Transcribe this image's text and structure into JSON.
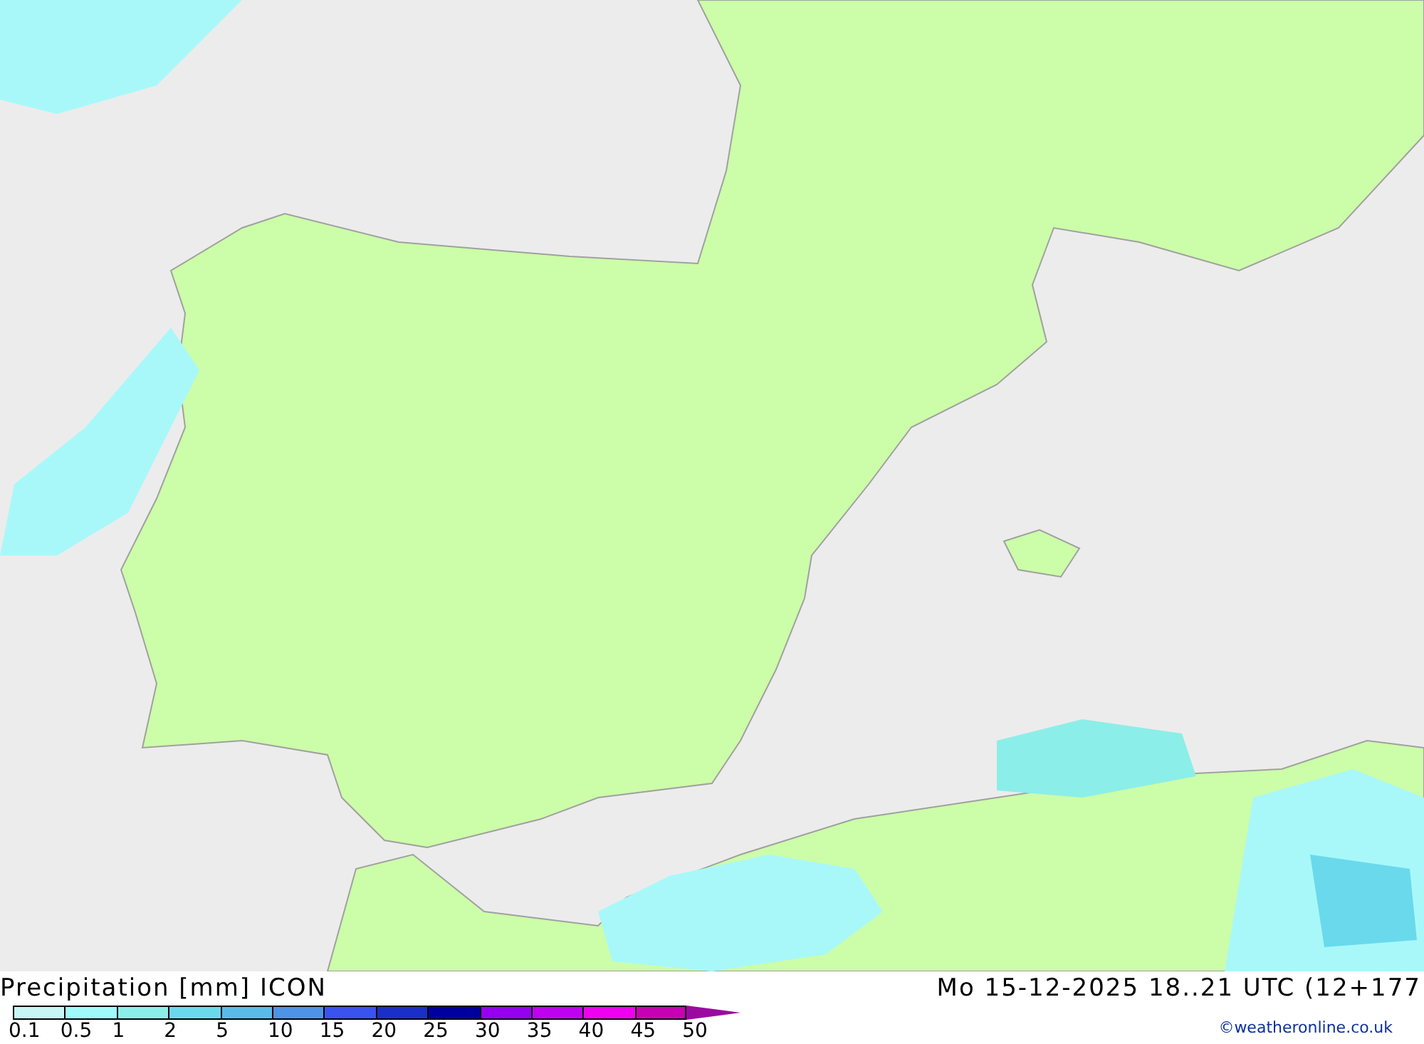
{
  "title": "Precipitation [mm] ICON",
  "valid_time": "Mo 15-12-2025 18..21 UTC (12+177",
  "credit": "©weatheronline.co.uk",
  "legend": [
    {
      "label": "0.1",
      "color": "#c8f5f5"
    },
    {
      "label": "0.5",
      "color": "#a0fafa"
    },
    {
      "label": "1",
      "color": "#8ceee8"
    },
    {
      "label": "2",
      "color": "#6ad9ec"
    },
    {
      "label": "5",
      "color": "#5bbbe8"
    },
    {
      "label": "10",
      "color": "#4f93e6"
    },
    {
      "label": "15",
      "color": "#3a52f0"
    },
    {
      "label": "20",
      "color": "#1a2fc8"
    },
    {
      "label": "25",
      "color": "#0000a0"
    },
    {
      "label": "30",
      "color": "#9600f0"
    },
    {
      "label": "35",
      "color": "#c000f0"
    },
    {
      "label": "40",
      "color": "#f000f0"
    },
    {
      "label": "45",
      "color": "#c800b4"
    },
    {
      "label": "50",
      "color": "#9b0aa0"
    }
  ]
}
